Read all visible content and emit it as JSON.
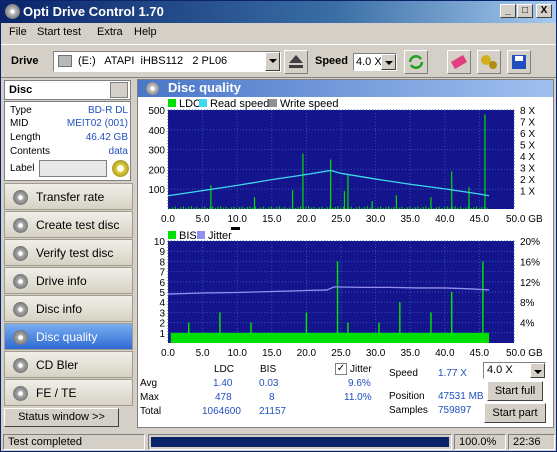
{
  "window": {
    "title": "Opti Drive Control 1.70",
    "min": "_",
    "max": "□",
    "close": "X"
  },
  "menu": [
    "File",
    "Start test",
    "Extra",
    "Help"
  ],
  "toolbar": {
    "drive_label": "Drive",
    "drive_value": "(E:)   ATAPI  iHBS112   2 PL06",
    "speed_label": "Speed",
    "speed_value": "4.0 X"
  },
  "disc": {
    "header": "Disc",
    "rows": [
      {
        "k": "Type",
        "v": "BD-R DL"
      },
      {
        "k": "MID",
        "v": "MEIT02 (001)"
      },
      {
        "k": "Length",
        "v": "46.42 GB"
      },
      {
        "k": "Contents",
        "v": "data"
      }
    ],
    "label_key": "Label"
  },
  "nav": [
    {
      "label": "Transfer rate",
      "active": false
    },
    {
      "label": "Create test disc",
      "active": false
    },
    {
      "label": "Verify test disc",
      "active": false
    },
    {
      "label": "Drive info",
      "active": false
    },
    {
      "label": "Disc info",
      "active": false
    },
    {
      "label": "Disc quality",
      "active": true
    },
    {
      "label": "CD Bler",
      "active": false
    },
    {
      "label": "FE / TE",
      "active": false
    }
  ],
  "status_window_btn": "Status window >>",
  "panel_title": "Disc quality",
  "colors": {
    "plot_bg": "#14148c",
    "green": "#00e000",
    "cyan": "#40d8f0",
    "jitter": "#9090f0",
    "active_nav": "#2d6ad4"
  },
  "chart_data": [
    {
      "type": "bar",
      "legend": [
        "LDC",
        "Read speed",
        "Write speed"
      ],
      "x_ticks": [
        "0.0",
        "5.0",
        "10.0",
        "15.0",
        "20.0",
        "25.0",
        "30.0",
        "35.0",
        "40.0",
        "45.0",
        "50.0 GB"
      ],
      "y_left_ticks": [
        "500",
        "400",
        "300",
        "200",
        "100"
      ],
      "y_right_ticks": [
        "8 X",
        "7 X",
        "6 X",
        "5 X",
        "4 X",
        "3 X",
        "2 X",
        "1 X"
      ],
      "ylim": [
        0,
        500
      ],
      "xlim": [
        0,
        50
      ],
      "ldc_spikes": [
        [
          6.2,
          120
        ],
        [
          12.5,
          60
        ],
        [
          18.0,
          95
        ],
        [
          19.5,
          280
        ],
        [
          23.5,
          250
        ],
        [
          25.5,
          90
        ],
        [
          26.0,
          175
        ],
        [
          29.5,
          40
        ],
        [
          33.0,
          70
        ],
        [
          38.0,
          60
        ],
        [
          41.0,
          190
        ],
        [
          43.5,
          110
        ],
        [
          45.8,
          478
        ]
      ],
      "read_speed": [
        [
          0,
          1.15
        ],
        [
          5,
          1.6
        ],
        [
          10,
          2.05
        ],
        [
          15,
          2.55
        ],
        [
          20,
          3.0
        ],
        [
          23.5,
          3.35
        ],
        [
          25,
          3.1
        ],
        [
          30,
          2.6
        ],
        [
          35,
          2.15
        ],
        [
          40,
          1.75
        ],
        [
          45,
          1.3
        ],
        [
          46.4,
          1.15
        ]
      ]
    },
    {
      "type": "bar",
      "legend": [
        "BIS",
        "Jitter"
      ],
      "x_ticks": [
        "0.0",
        "5.0",
        "10.0",
        "15.0",
        "20.0",
        "25.0",
        "30.0",
        "35.0",
        "40.0",
        "45.0",
        "50.0 GB"
      ],
      "y_left_ticks": [
        "10",
        "9",
        "8",
        "7",
        "6",
        "5",
        "4",
        "3",
        "2",
        "1"
      ],
      "y_right_ticks": [
        "20%",
        "16%",
        "12%",
        "8%",
        "4%"
      ],
      "ylim": [
        0,
        10
      ],
      "xlim": [
        0,
        50
      ],
      "bis_spikes": [
        [
          3.0,
          2
        ],
        [
          7.5,
          3
        ],
        [
          12.0,
          2
        ],
        [
          20.0,
          3
        ],
        [
          24.5,
          8
        ],
        [
          26.0,
          2
        ],
        [
          30.5,
          2
        ],
        [
          33.5,
          4
        ],
        [
          38.0,
          3
        ],
        [
          41.0,
          5
        ],
        [
          45.5,
          8
        ]
      ],
      "jitter": [
        [
          0,
          9.6
        ],
        [
          5,
          9.8
        ],
        [
          10,
          9.9
        ],
        [
          15,
          10.1
        ],
        [
          20,
          10.3
        ],
        [
          23,
          10.4
        ],
        [
          24,
          11.0
        ],
        [
          28,
          10.9
        ],
        [
          32,
          10.9
        ],
        [
          36,
          10.8
        ],
        [
          40,
          10.8
        ],
        [
          44,
          10.6
        ],
        [
          46.4,
          10.4
        ]
      ]
    }
  ],
  "stats": {
    "col_ldc": "LDC",
    "col_bis": "BIS",
    "rows": [
      {
        "k": "Avg",
        "ldc": "1.40",
        "bis": "0.03",
        "jitter": "9.6%"
      },
      {
        "k": "Max",
        "ldc": "478",
        "bis": "8",
        "jitter": "11.0%"
      },
      {
        "k": "Total",
        "ldc": "1064600",
        "bis": "21157",
        "jitter": ""
      }
    ],
    "jitter_label": "Jitter",
    "speed_label": "Speed",
    "speed_value": "1.77 X",
    "position_label": "Position",
    "position_value": "47531 MB",
    "samples_label": "Samples",
    "samples_value": "759897",
    "speed_select": "4.0 X",
    "start_full": "Start full",
    "start_part": "Start part"
  },
  "status": {
    "text": "Test completed",
    "progress": 1.0,
    "progress_text": "100.0%",
    "time": "22:36"
  }
}
